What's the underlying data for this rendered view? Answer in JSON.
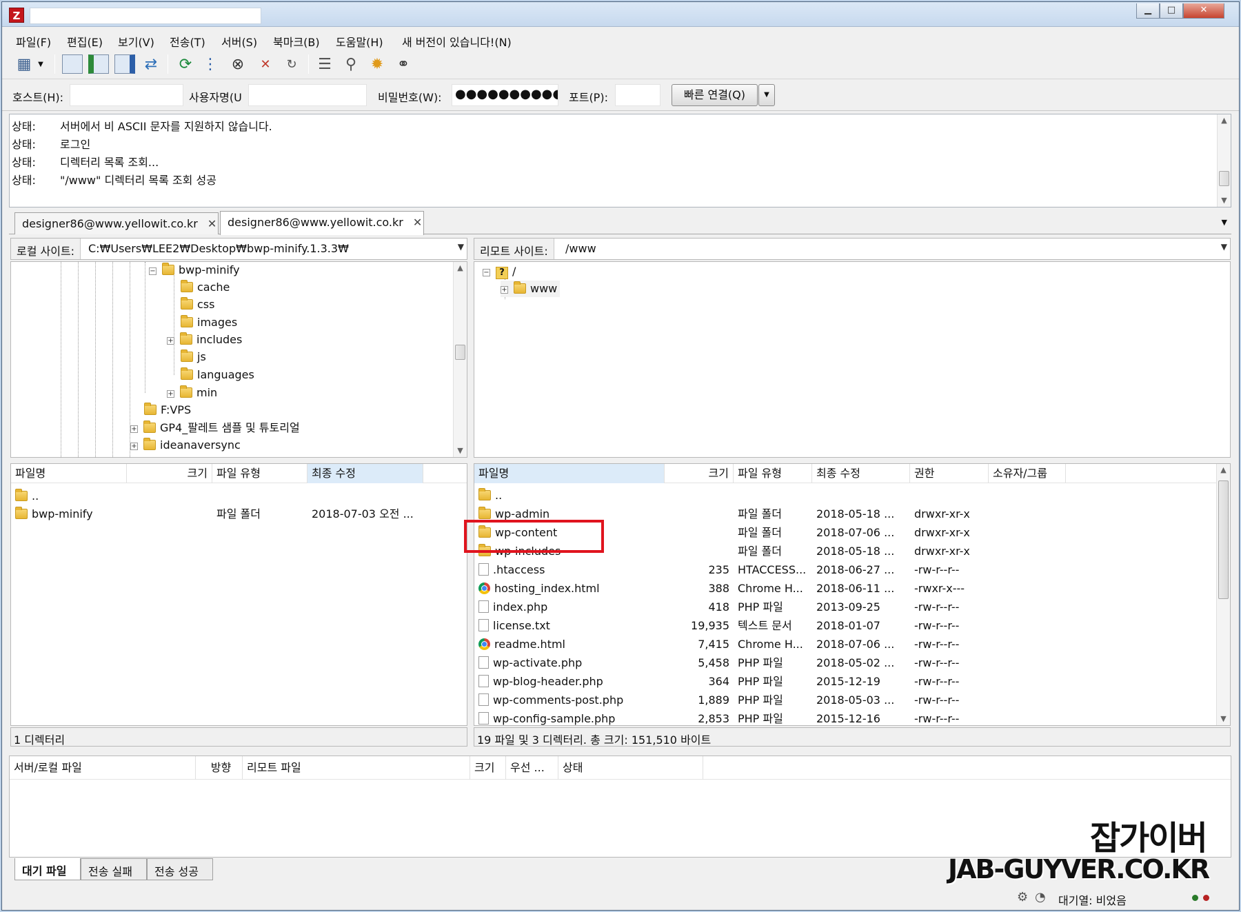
{
  "window": {
    "title": "",
    "controls": {
      "minimize": "▁",
      "maximize": "□",
      "close": "✕"
    }
  },
  "menu": [
    "파일(F)",
    "편집(E)",
    "보기(V)",
    "전송(T)",
    "서버(S)",
    "북마크(B)",
    "도움말(H)",
    "새 버전이 있습니다!(N)"
  ],
  "quickconnect": {
    "host_label": "호스트(H):",
    "host_value": "",
    "user_label": "사용자명(U",
    "user_value": "",
    "pass_label": "비밀번호(W):",
    "pass_value": "●●●●●●●●●●",
    "port_label": "포트(P):",
    "port_value": "",
    "connect_label": "빠른 연결(Q)",
    "dropdown": "▼"
  },
  "log": [
    {
      "key": "상태:",
      "msg": "서버에서 비 ASCII 문자를 지원하지 않습니다."
    },
    {
      "key": "상태:",
      "msg": "로그인"
    },
    {
      "key": "상태:",
      "msg": "디렉터리 목록 조회..."
    },
    {
      "key": "상태:",
      "msg": "\"/www\" 디렉터리 목록 조회 성공"
    }
  ],
  "tabs": [
    {
      "label": "designer86@www.yellowit.co.kr",
      "close": "✕"
    },
    {
      "label": "designer86@www.yellowit.co.kr",
      "close": "✕"
    }
  ],
  "local": {
    "site_label": "로컬 사이트:",
    "path": "C:₩Users₩LEE2₩Desktop₩bwp-minify.1.3.3₩",
    "tree": [
      {
        "name": "bwp-minify",
        "expander": "−"
      },
      {
        "name": "cache",
        "expander": ""
      },
      {
        "name": "css",
        "expander": ""
      },
      {
        "name": "images",
        "expander": ""
      },
      {
        "name": "includes",
        "expander": "+"
      },
      {
        "name": "js",
        "expander": ""
      },
      {
        "name": "languages",
        "expander": ""
      },
      {
        "name": "min",
        "expander": "+"
      },
      {
        "name": "F:VPS",
        "expander": ""
      },
      {
        "name": "GP4_팔레트 샘플 및 튜토리얼",
        "expander": "+"
      },
      {
        "name": "ideanaversync",
        "expander": "+"
      }
    ],
    "columns": [
      "파일명",
      "크기",
      "파일 유형",
      "최종 수정"
    ],
    "files": [
      {
        "name": "..",
        "size": "",
        "type": "",
        "modified": ""
      },
      {
        "name": "bwp-minify",
        "size": "",
        "type": "파일 폴더",
        "modified": "2018-07-03 오전 ..."
      }
    ],
    "status": "1 디렉터리"
  },
  "remote": {
    "site_label": "리모트 사이트:",
    "path": "/www",
    "tree": [
      {
        "name": "/",
        "expander": "−"
      },
      {
        "name": "www",
        "expander": "+"
      }
    ],
    "columns": [
      "파일명",
      "크기",
      "파일 유형",
      "최종 수정",
      "권한",
      "소유자/그룹"
    ],
    "files": [
      {
        "name": "..",
        "icon": "folder",
        "size": "",
        "type": "",
        "modified": "",
        "perm": ""
      },
      {
        "name": "wp-admin",
        "icon": "folder",
        "size": "",
        "type": "파일 폴더",
        "modified": "2018-05-18 ...",
        "perm": "drwxr-xr-x"
      },
      {
        "name": "wp-content",
        "icon": "folder",
        "size": "",
        "type": "파일 폴더",
        "modified": "2018-07-06 ...",
        "perm": "drwxr-xr-x"
      },
      {
        "name": "wp-includes",
        "icon": "folder",
        "size": "",
        "type": "파일 폴더",
        "modified": "2018-05-18 ...",
        "perm": "drwxr-xr-x"
      },
      {
        "name": ".htaccess",
        "icon": "file",
        "size": "235",
        "type": "HTACCESS...",
        "modified": "2018-06-27 ...",
        "perm": "-rw-r--r--"
      },
      {
        "name": "hosting_index.html",
        "icon": "chrome",
        "size": "388",
        "type": "Chrome H...",
        "modified": "2018-06-11 ...",
        "perm": "-rwxr-x---"
      },
      {
        "name": "index.php",
        "icon": "file",
        "size": "418",
        "type": "PHP 파일",
        "modified": "2013-09-25",
        "perm": "-rw-r--r--"
      },
      {
        "name": "license.txt",
        "icon": "file",
        "size": "19,935",
        "type": "텍스트 문서",
        "modified": "2018-01-07",
        "perm": "-rw-r--r--"
      },
      {
        "name": "readme.html",
        "icon": "chrome",
        "size": "7,415",
        "type": "Chrome H...",
        "modified": "2018-07-06 ...",
        "perm": "-rw-r--r--"
      },
      {
        "name": "wp-activate.php",
        "icon": "file",
        "size": "5,458",
        "type": "PHP 파일",
        "modified": "2018-05-02 ...",
        "perm": "-rw-r--r--"
      },
      {
        "name": "wp-blog-header.php",
        "icon": "file",
        "size": "364",
        "type": "PHP 파일",
        "modified": "2015-12-19",
        "perm": "-rw-r--r--"
      },
      {
        "name": "wp-comments-post.php",
        "icon": "file",
        "size": "1,889",
        "type": "PHP 파일",
        "modified": "2018-05-03 ...",
        "perm": "-rw-r--r--"
      },
      {
        "name": "wp-config-sample.php",
        "icon": "file",
        "size": "2,853",
        "type": "PHP 파일",
        "modified": "2015-12-16",
        "perm": "-rw-r--r--"
      }
    ],
    "status": "19 파일 및 3 디렉터리. 총 크기: 151,510 바이트"
  },
  "queue": {
    "columns": [
      "서버/로컬 파일",
      "방향",
      "리모트 파일",
      "크기",
      "우선 ...",
      "상태"
    ],
    "tabs": [
      "대기 파일",
      "전송 실패",
      "전송 성공"
    ]
  },
  "statusbar": {
    "queue_label": "대기열: 비었음"
  },
  "watermark": {
    "line1": "잡가이버",
    "line2": "JAB-GUYVER.CO.KR"
  },
  "colors": {
    "highlight": "#e0141e",
    "accent": "#dcebf9"
  }
}
